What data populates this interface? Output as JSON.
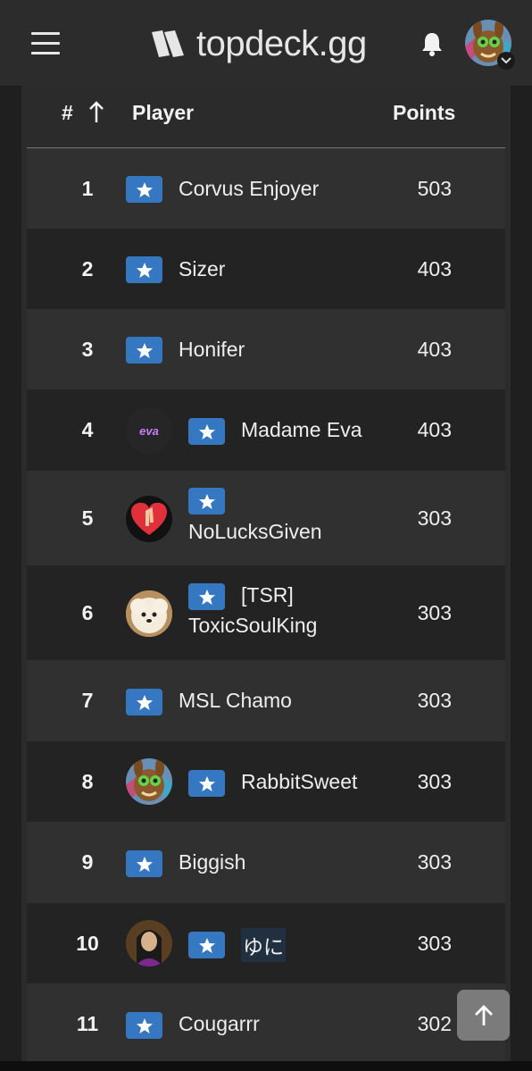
{
  "header": {
    "brand": "topdeck.gg",
    "icons": {
      "menu": "hamburger-menu-icon",
      "logo": "topdeck-logo-icon",
      "notifications": "bell-icon",
      "avatar": "rabbit-avatar-icon",
      "dropdown": "chevron-down-icon"
    }
  },
  "table": {
    "columns": {
      "rank": "#",
      "sort_icon": "arrow-up-icon",
      "player": "Player",
      "points": "Points"
    },
    "rows": [
      {
        "rank": "1",
        "name": "Corvus Enjoyer",
        "points": "503"
      },
      {
        "rank": "2",
        "name": "Sizer",
        "points": "403"
      },
      {
        "rank": "3",
        "name": "Honifer",
        "points": "403"
      },
      {
        "rank": "4",
        "name": "Madame Eva",
        "points": "403",
        "avatar_text": "eva"
      },
      {
        "rank": "5",
        "name": "NoLucksGiven",
        "points": "303"
      },
      {
        "rank": "6",
        "name": "[TSR]",
        "name2": "ToxicSoulKing",
        "points": "303"
      },
      {
        "rank": "7",
        "name": "MSL Chamo",
        "points": "303"
      },
      {
        "rank": "8",
        "name": "RabbitSweet",
        "points": "303"
      },
      {
        "rank": "9",
        "name": "Biggish",
        "points": "303"
      },
      {
        "rank": "10",
        "name": "ゆに",
        "points": "303"
      },
      {
        "rank": "11",
        "name": "Cougarrr",
        "points": "302"
      }
    ]
  },
  "colors": {
    "badge": "#3577c0",
    "row_light": "#303030",
    "row_dark": "#232323",
    "topbar": "#2c2c2c"
  },
  "scroll_top": {
    "icon": "arrow-up-icon"
  }
}
